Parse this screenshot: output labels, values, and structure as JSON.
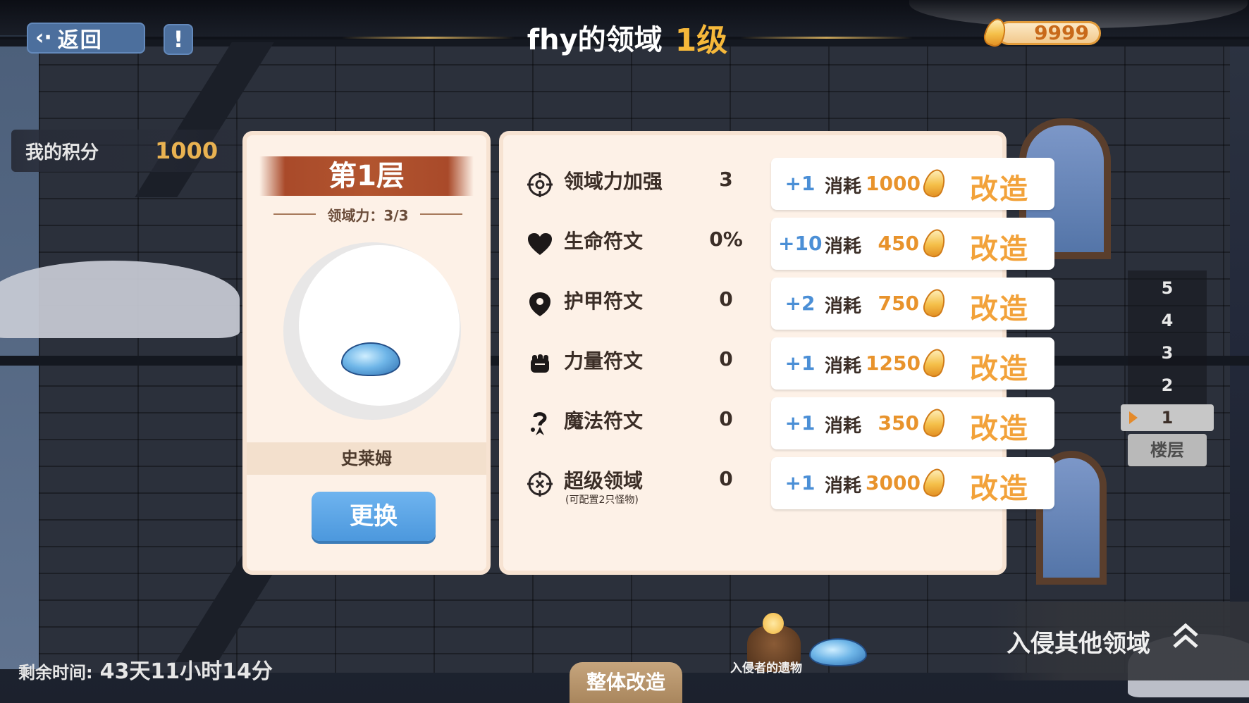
{
  "header": {
    "back_label": "返回",
    "info_label": "!",
    "domain_name": "fhy的领域",
    "domain_level": "1级",
    "currency_amount": "9999"
  },
  "score": {
    "label": "我的积分",
    "value": "1000"
  },
  "layer": {
    "title": "第1层",
    "power": "领域力：3/3",
    "monster_name": "史莱姆",
    "swap_label": "更换"
  },
  "upgrades": [
    {
      "icon": "crosshair-icon",
      "name": "领域力加强",
      "sub": "",
      "value": "3",
      "plus": "+1",
      "cost_label": "消耗",
      "cost": "1000",
      "action": "改造"
    },
    {
      "icon": "heart-icon",
      "name": "生命符文",
      "sub": "",
      "value": "0%",
      "plus": "+10",
      "cost_label": "消耗",
      "cost": "450",
      "action": "改造"
    },
    {
      "icon": "shield-icon",
      "name": "护甲符文",
      "sub": "",
      "value": "0",
      "plus": "+2",
      "cost_label": "消耗",
      "cost": "750",
      "action": "改造"
    },
    {
      "icon": "fist-icon",
      "name": "力量符文",
      "sub": "",
      "value": "0",
      "plus": "+1",
      "cost_label": "消耗",
      "cost": "1250",
      "action": "改造"
    },
    {
      "icon": "magic-icon",
      "name": "魔法符文",
      "sub": "",
      "value": "0",
      "plus": "+1",
      "cost_label": "消耗",
      "cost": "350",
      "action": "改造"
    },
    {
      "icon": "target-icon",
      "name": "超级领域",
      "sub": "(可配置2只怪物)",
      "value": "0",
      "plus": "+1",
      "cost_label": "消耗",
      "cost": "3000",
      "action": "改造"
    }
  ],
  "floors": {
    "items": [
      "5",
      "4",
      "3",
      "2",
      "1"
    ],
    "selected": "1",
    "label": "楼层"
  },
  "footer": {
    "time_label": "剩余时间:",
    "time_value": "43天11小时14分",
    "whole_upgrade_label": "整体改造",
    "relic_label": "入侵者的遗物",
    "invade_label": "入侵其他领域"
  },
  "colors": {
    "accent_gold": "#f6b83a",
    "action_orange": "#f2a23a",
    "plus_blue": "#4b8fd6",
    "button_blue": "#4c98dd",
    "banner_rust": "#a94a2a",
    "panel_cream": "#fdf1e7"
  }
}
